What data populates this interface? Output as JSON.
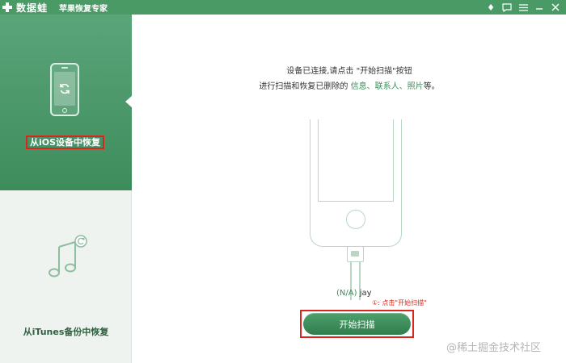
{
  "app": {
    "brand": "数据蛙",
    "subtitle": "苹果恢复专家"
  },
  "titlebar_icons": [
    "diamond-icon",
    "chat-icon",
    "menu-icon",
    "minimize-icon",
    "close-icon"
  ],
  "sidebar": {
    "items": [
      {
        "label": "从iOS设备中恢复",
        "active": true,
        "icon": "phone-restore-icon"
      },
      {
        "label": "从iTunes备份中恢复",
        "active": false,
        "icon": "music-note-icon"
      }
    ]
  },
  "main": {
    "instruction_line1": "设备已连接,请点击 \"开始扫描\"按钮",
    "instruction_line2_prefix": "进行扫描和恢复已删除的 ",
    "instruction_highlights": "信息、联系人、照片",
    "instruction_line2_suffix": "等。",
    "device_status": "(N/A)",
    "device_name": "jay",
    "annotation": "①: 点击\"开始扫描\"",
    "scan_button": "开始扫描"
  },
  "watermark": "@稀土掘金技术社区",
  "colors": {
    "brand_green": "#4a9a66",
    "highlight_red": "#d9251d",
    "phone_outline": "#b9d6c3"
  }
}
